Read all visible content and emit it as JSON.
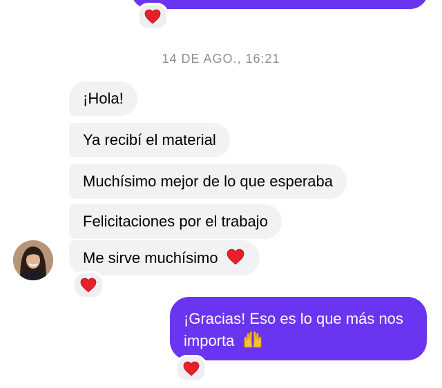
{
  "top_reaction": {
    "emoji": "heart-icon"
  },
  "timestamp": "14 DE AGO., 16:21",
  "incoming": {
    "messages": [
      {
        "text": "¡Hola!"
      },
      {
        "text": "Ya recibí el material"
      },
      {
        "text": "Muchísimo mejor de lo que esperaba"
      },
      {
        "text": "Felicitaciones por el trabajo"
      },
      {
        "text": "Me sirve muchísimo"
      }
    ],
    "reaction": "heart-icon"
  },
  "outgoing": {
    "line1": "¡Gracias! Eso es lo que más nos",
    "line2": "importa",
    "reaction": "heart-icon"
  },
  "colors": {
    "outgoing_bubble": "#6a35f0",
    "incoming_bubble": "#f2f2f4",
    "heart": "#e8202a",
    "timestamp": "#8e8e93"
  }
}
